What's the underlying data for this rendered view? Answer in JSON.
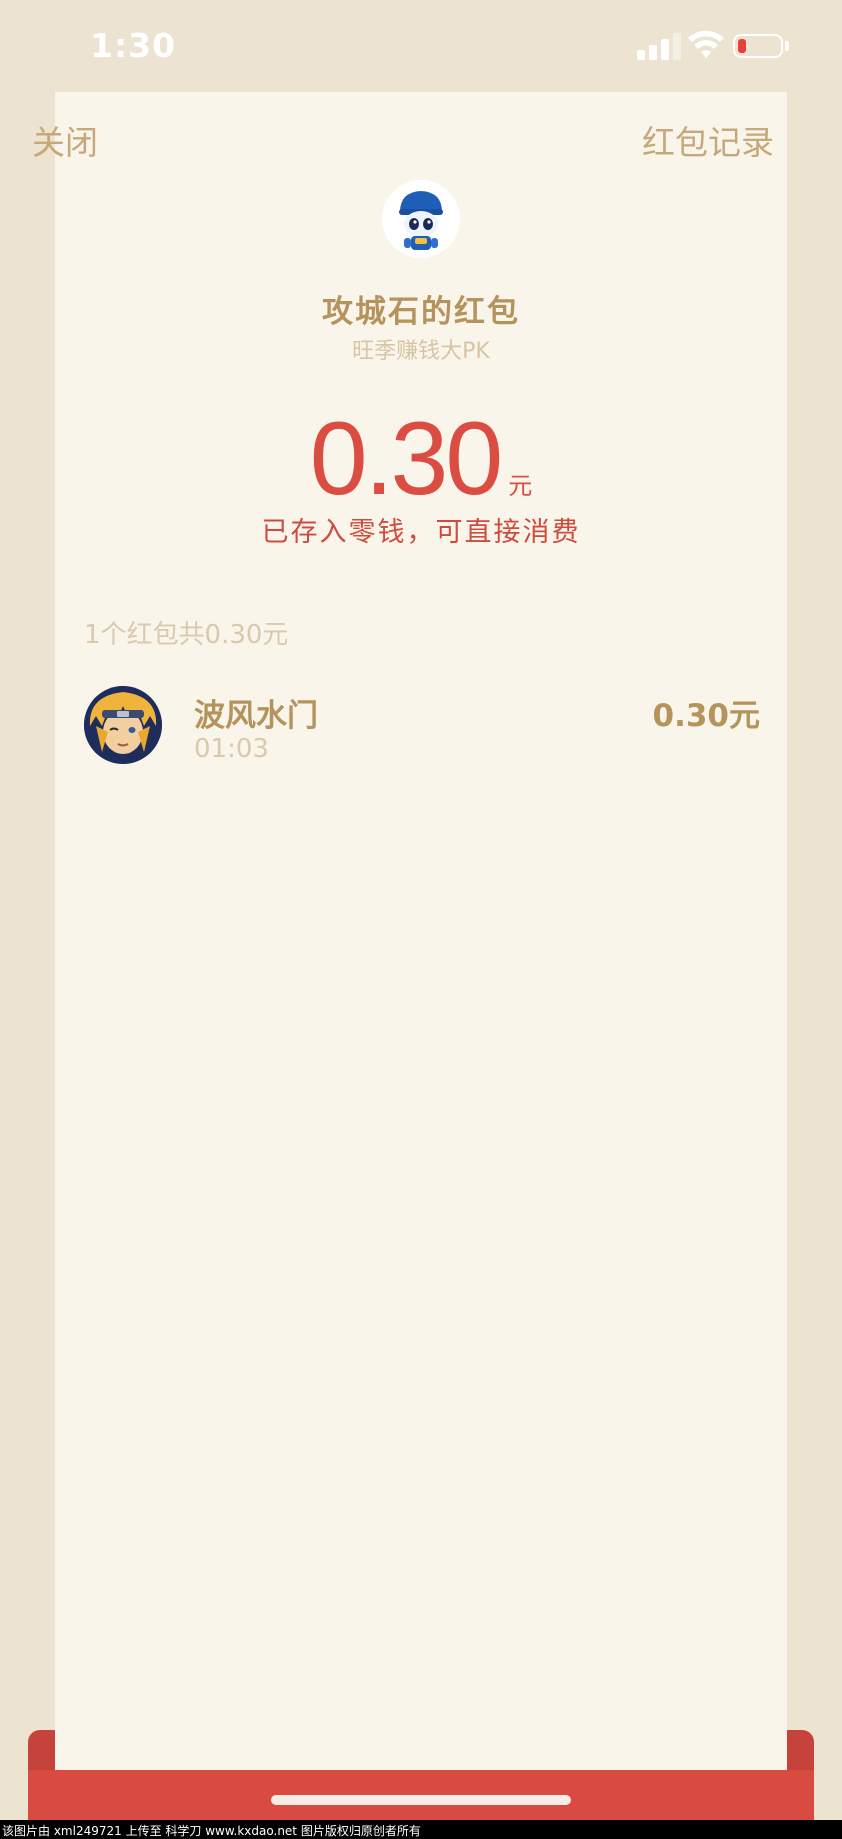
{
  "status_bar": {
    "time": "1:30"
  },
  "nav": {
    "close_label": "关闭",
    "records_label": "红包记录"
  },
  "envelope": {
    "sender_title": "攻城石的红包",
    "greeting": "旺季赚钱大PK",
    "amount": "0.30",
    "unit": "元",
    "deposit_note": "已存入零钱，可直接消费"
  },
  "summary": "1个红包共0.30元",
  "recipients": [
    {
      "name": "波风水门",
      "time": "01:03",
      "amount": "0.30元"
    }
  ],
  "watermark": "该图片由 xml249721 上传至 科学刀 www.kxdao.net 图片版权归原创者所有",
  "colors": {
    "accent_red": "#db4d42",
    "gold_text": "#b5935c",
    "card_bg": "#faf5ea",
    "page_bg": "#ece3d1"
  },
  "icons": {
    "signal": "cellular-signal-icon",
    "wifi": "wifi-icon",
    "battery": "battery-low-icon"
  }
}
